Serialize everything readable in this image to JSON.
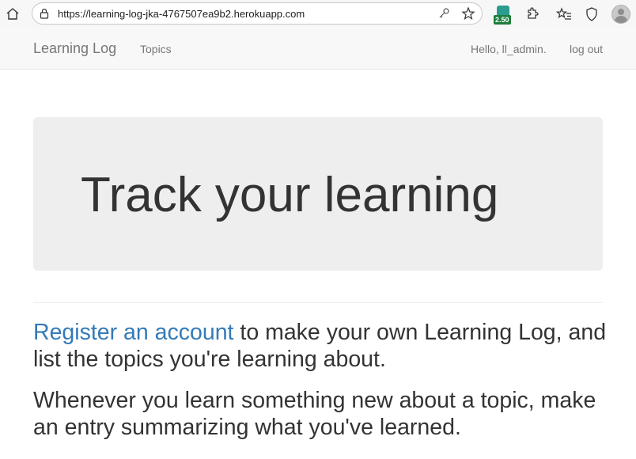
{
  "browser": {
    "url": "https://learning-log-jka-4767507ea9b2.herokuapp.com",
    "extension_badge": "2.50"
  },
  "navbar": {
    "brand": "Learning Log",
    "topics_link": "Topics",
    "greeting": "Hello, ll_admin.",
    "logout_link": "log out"
  },
  "jumbotron": {
    "heading": "Track your learning"
  },
  "content": {
    "register_link": "Register an account",
    "para1_rest": " to make your own Learning Log, and list the topics you're learning about.",
    "para2": "Whenever you learn something new about a topic, make an entry summarizing what you've learned."
  }
}
